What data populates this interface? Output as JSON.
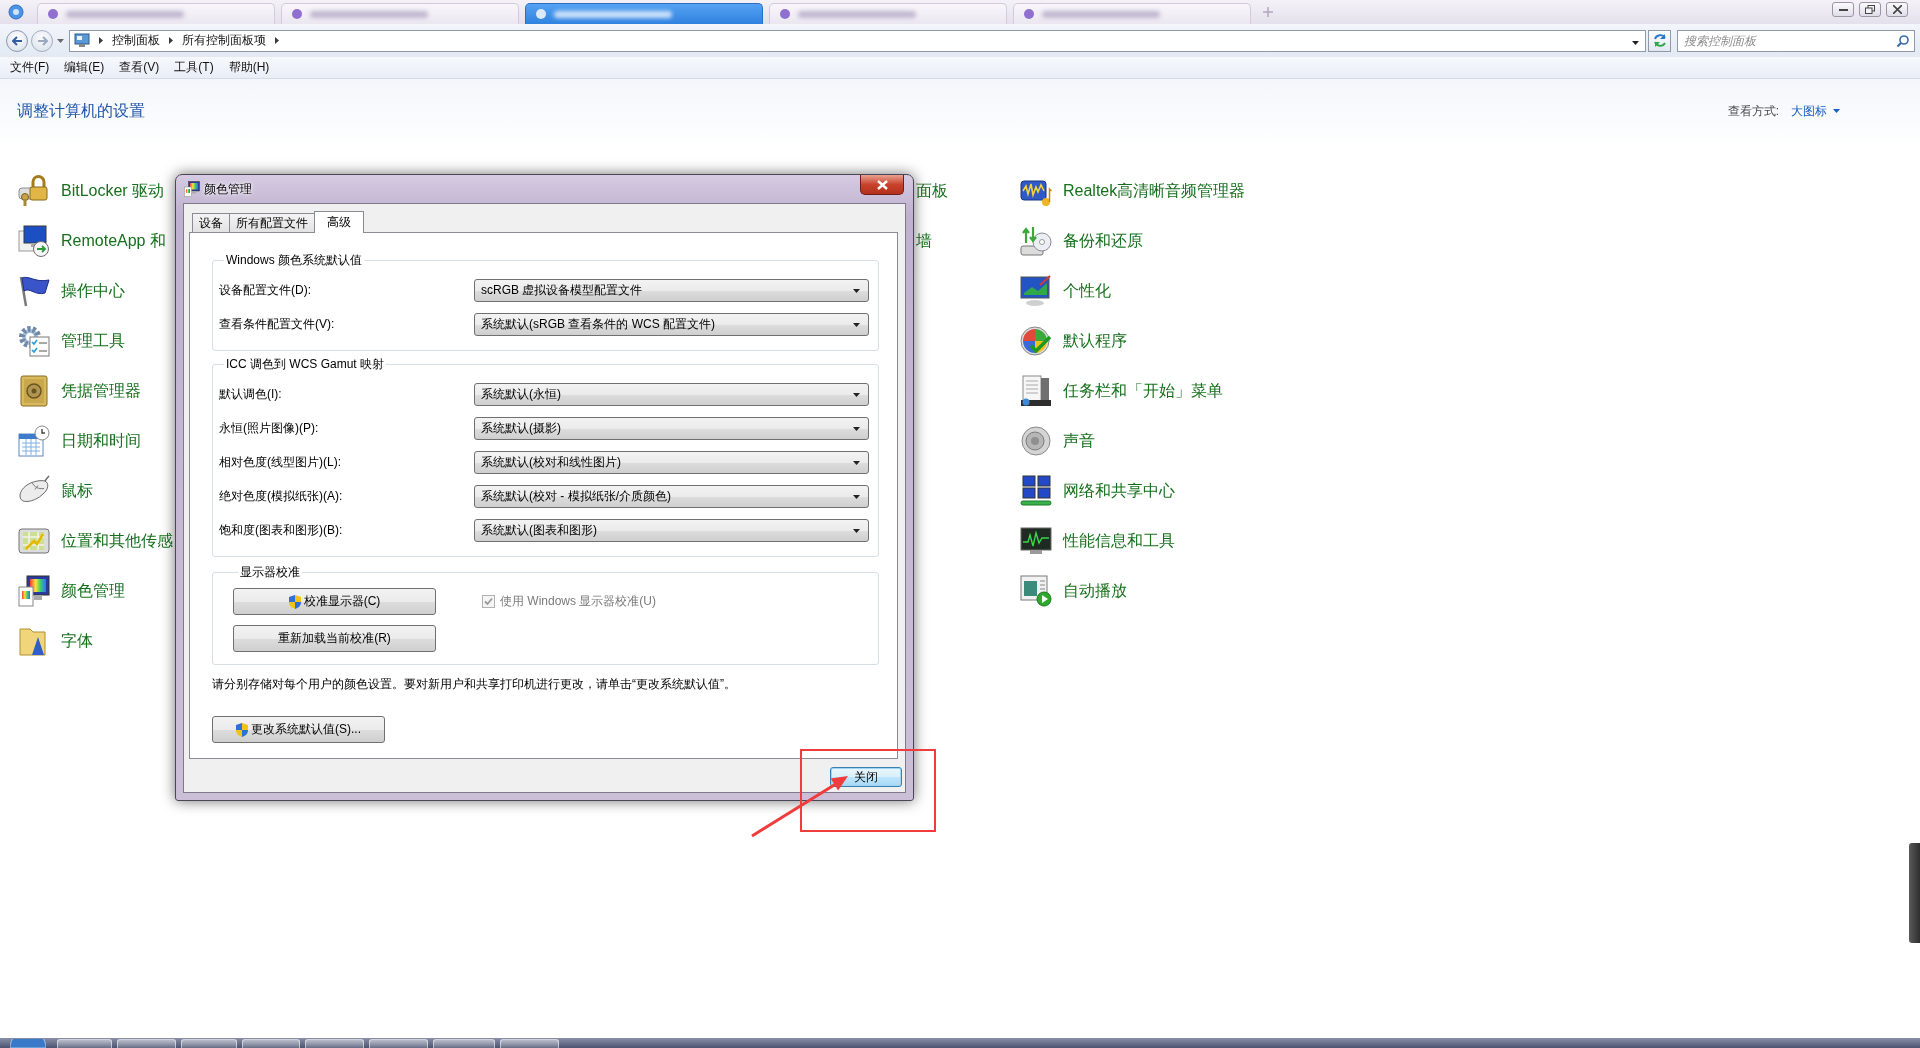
{
  "browser_tabs": [
    {
      "selected": false
    },
    {
      "selected": false
    },
    {
      "selected": true
    },
    {
      "selected": false
    },
    {
      "selected": false
    }
  ],
  "address_bar": {
    "path": [
      "控制面板",
      "所有控制面板项"
    ]
  },
  "search": {
    "placeholder": "搜索控制面板"
  },
  "menu": [
    "文件(F)",
    "编辑(E)",
    "查看(V)",
    "工具(T)",
    "帮助(H)"
  ],
  "header": {
    "title": "调整计算机的设置",
    "view_label": "查看方式:",
    "view_value": "大图标"
  },
  "columns": [
    {
      "items": [
        "BitLocker 驱动",
        "RemoteApp 和",
        "操作中心",
        "管理工具",
        "凭据管理器",
        "日期和时间",
        "鼠标",
        "位置和其他传感",
        "颜色管理",
        "字体"
      ]
    },
    {
      "items": [
        "面板",
        "墙"
      ]
    },
    {
      "items": [
        "Realtek高清晰音频管理器",
        "备份和还原",
        "个性化",
        "默认程序",
        "任务栏和「开始」菜单",
        "声音",
        "网络和共享中心",
        "性能信息和工具",
        "自动播放"
      ]
    }
  ],
  "dialog": {
    "title": "颜色管理",
    "tabs": [
      {
        "label": "设备",
        "selected": false
      },
      {
        "label": "所有配置文件",
        "selected": false
      },
      {
        "label": "高级",
        "selected": true
      }
    ],
    "groups": [
      {
        "title": "Windows 颜色系统默认值",
        "rows": [
          {
            "label": "设备配置文件(D):",
            "value": "scRGB 虚拟设备模型配置文件"
          },
          {
            "label": "查看条件配置文件(V):",
            "value": "系统默认(sRGB 查看条件的 WCS 配置文件)"
          }
        ]
      },
      {
        "title": "ICC 调色到 WCS Gamut 映射",
        "rows": [
          {
            "label": "默认调色(I):",
            "value": "系统默认(永恒)"
          },
          {
            "label": "永恒(照片图像)(P):",
            "value": "系统默认(摄影)"
          },
          {
            "label": "相对色度(线型图片)(L):",
            "value": "系统默认(校对和线性图片)"
          },
          {
            "label": "绝对色度(模拟纸张)(A):",
            "value": "系统默认(校对 - 模拟纸张/介质颜色)"
          },
          {
            "label": "饱和度(图表和图形)(B):",
            "value": "系统默认(图表和图形)"
          }
        ]
      }
    ],
    "calibration": {
      "title": "显示器校准",
      "buttons": [
        {
          "label": "校准显示器(C)",
          "kind": "admin"
        },
        {
          "label": "重新加载当前校准(R)",
          "kind": "plain"
        }
      ],
      "checkbox": {
        "label": "使用 Windows 显示器校准(U)",
        "checked": true,
        "disabled": true
      }
    },
    "note": "请分别存储对每个用户的颜色设置。要对新用户和共享打印机进行更改，请单击“更改系统默认值”。",
    "change_button": {
      "label": "更改系统默认值(S)...",
      "kind": "admin"
    },
    "close_button": {
      "label": "关闭",
      "focused": true
    }
  }
}
